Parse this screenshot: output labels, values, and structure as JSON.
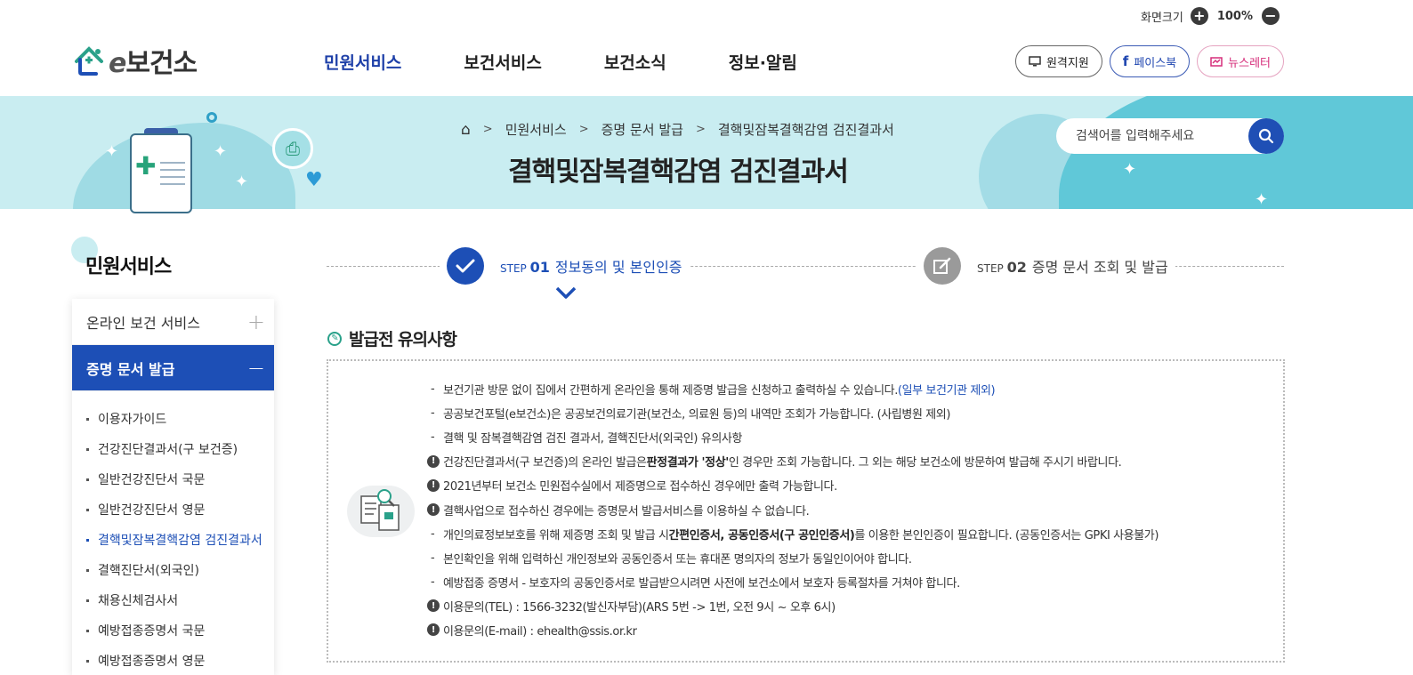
{
  "zoom": {
    "label": "화면크기",
    "value": "100%",
    "plus": "+",
    "minus": "−"
  },
  "logo": {
    "e": "e",
    "text": "보건소"
  },
  "gnb": [
    "민원서비스",
    "보건서비스",
    "보건소식",
    "정보·알림"
  ],
  "header_buttons": {
    "remote": "원격지원",
    "facebook": "페이스북",
    "newsletter": "뉴스레터"
  },
  "breadcrumb": [
    "민원서비스",
    "증명 문서 발급",
    "결핵및잠복결핵감염 검진결과서"
  ],
  "page_title": "결핵및잠복결핵감염 검진결과서",
  "search": {
    "placeholder": "검색어를 입력해주세요"
  },
  "sidebar": {
    "title": "민원서비스",
    "groups": [
      {
        "label": "온라인 보건 서비스",
        "sign": "+"
      },
      {
        "label": "증명 문서 발급",
        "sign": "−"
      }
    ],
    "items": [
      "이용자가이드",
      "건강진단결과서(구 보건증)",
      "일반건강진단서 국문",
      "일반건강진단서 영문",
      "결핵및잠복결핵감염 검진결과서",
      "결핵진단서(외국인)",
      "채용신체검사서",
      "예방접종증명서 국문",
      "예방접종증명서 영문"
    ]
  },
  "steps": [
    {
      "prefix": "STEP",
      "no": "01",
      "label": "정보동의 및 본인인증"
    },
    {
      "prefix": "STEP",
      "no": "02",
      "label": "증명 문서 조회 및 발급"
    }
  ],
  "notice": {
    "title": "발급전 유의사항",
    "l1a": "보건기관 방문 없이 집에서 간편하게 온라인을 통해 제증명 발급을 신청하고 출력하실 수 있습니다.",
    "l1b": "(일부 보건기관 제외)",
    "l2": "공공보건포털(e보건소)은 공공보건의료기관(보건소, 의료원 등)의 내역만 조회가 가능합니다. (사립병원 제외)",
    "l3": "결핵 및 잠복결핵감염 검진 결과서, 결핵진단서(외국인) 유의사항",
    "l4a": "건강진단결과서(구 보건증)의 온라인 발급은 ",
    "l4b": "판정결과가 '정상'",
    "l4c": "인 경우만 조회 가능합니다. 그 외는 해당 보건소에 방문하여 발급해 주시기 바랍니다.",
    "l5": "2021년부터 보건소 민원접수실에서 제증명으로 접수하신 경우에만 출력 가능합니다.",
    "l6": "결핵사업으로 접수하신 경우에는 증명문서 발급서비스를 이용하실 수 없습니다.",
    "l7a": "개인의료정보보호를 위해 제증명 조회 및 발급 시 ",
    "l7b": "간편인증서, 공동인증서(구 공인인증서)",
    "l7c": "를 이용한 본인인증이 필요합니다. (공동인증서는 GPKI 사용불가)",
    "l8": "본인확인을 위해 입력하신 개인정보와 공동인증서 또는 휴대폰 명의자의 정보가 동일인이어야 합니다.",
    "l9": "예방접종 증명서 - 보호자의 공동인증서로 발급받으시려면 사전에 보건소에서 보호자 등록절차를 거쳐야 합니다.",
    "l10": "이용문의(TEL) : 1566-3232(발신자부담)(ARS 5번 -> 1번, 오전 9시 ~ 오후 6시)",
    "l11": "이용문의(E-mail) : ehealth@ssis.or.kr"
  },
  "colors": {
    "primary": "#1d4fb6",
    "banner": "#c9edf1",
    "accent_teal": "#60c8d8"
  }
}
